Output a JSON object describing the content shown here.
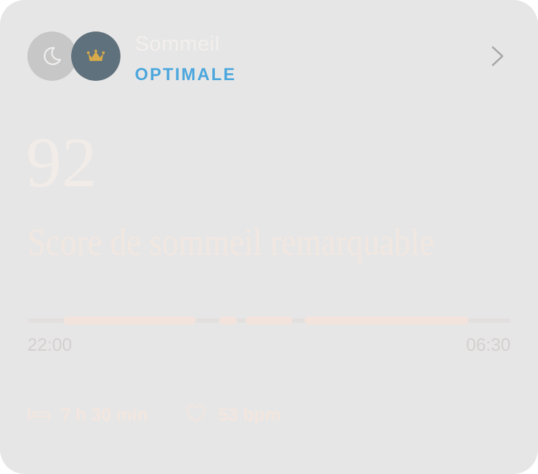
{
  "card": {
    "title": "Sommeil",
    "status": "OPTIMALE",
    "icons": [
      "moon-icon",
      "crown-icon",
      "chevron-right-icon"
    ],
    "score": "92",
    "headline": "Score de sommeil remarquable"
  },
  "timeline": {
    "start_time": "22:00",
    "end_time": "06:30"
  },
  "stats": {
    "duration": "7 h 30 min",
    "duration_icon": "bed-icon",
    "heart_rate": "53 bpm",
    "heart_rate_icon": "heart-icon"
  },
  "colors": {
    "card_background": "#e7e6e6",
    "status_accent": "#4ba7dd",
    "crown_badge_background": "#5f717c",
    "crown_gold": "#d6a94a",
    "moon_badge_background": "#c8c7c7"
  }
}
